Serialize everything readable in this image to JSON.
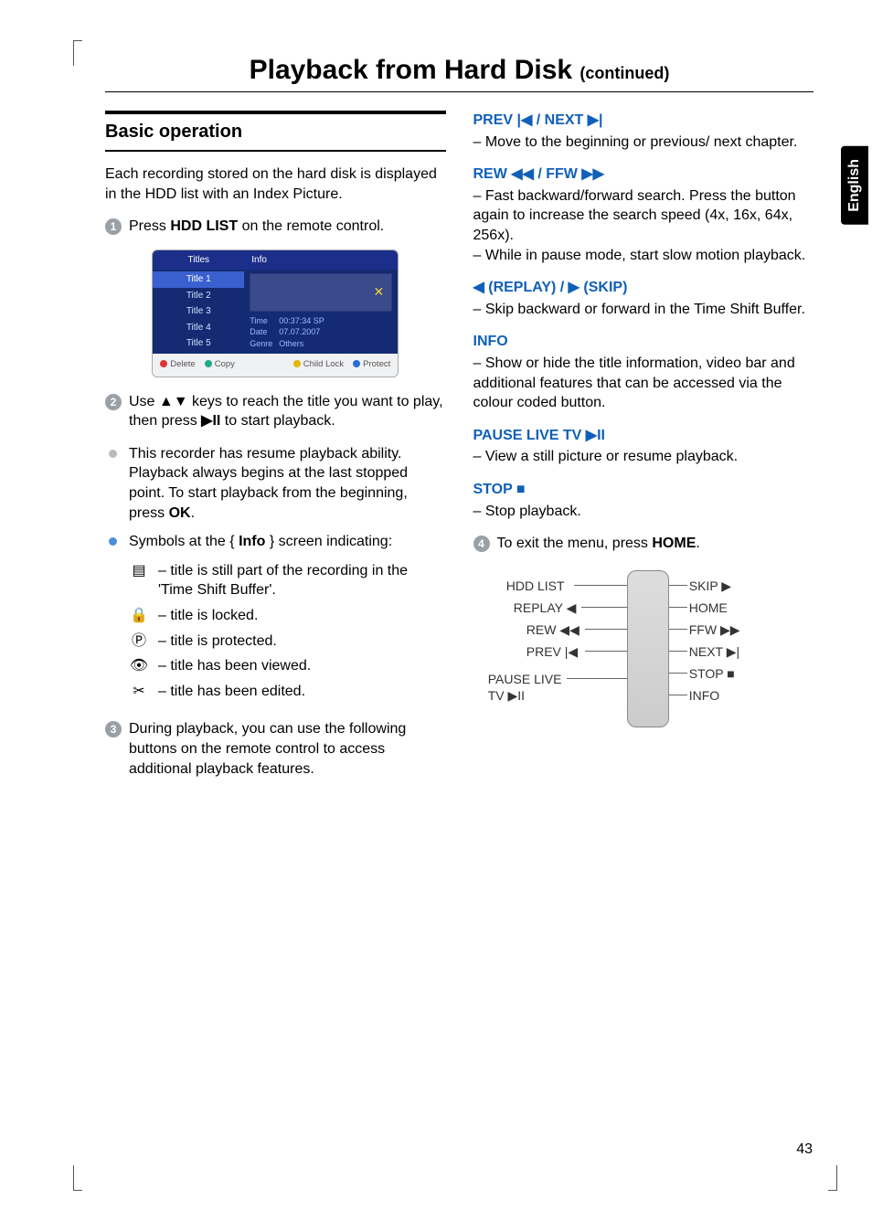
{
  "page_title_main": "Playback from Hard Disk",
  "page_title_cont": "(continued)",
  "language_tab": "English",
  "page_number": "43",
  "left": {
    "heading": "Basic operation",
    "intro": "Each recording stored on the hard disk is displayed in the HDD list with an Index Picture.",
    "step1_a": "Press ",
    "step1_b": "HDD LIST",
    "step1_c": " on the remote control.",
    "hdd": {
      "col_titles": "Titles",
      "col_info": "Info",
      "titles": [
        "Title 1",
        "Title 2",
        "Title 3",
        "Title 4",
        "Title 5"
      ],
      "meta_time_k": "Time",
      "meta_time_v": "00:37:34  SP",
      "meta_date_k": "Date",
      "meta_date_v": "07.07.2007",
      "meta_genre_k": "Genre",
      "meta_genre_v": "Others",
      "foot_delete": "Delete",
      "foot_copy": "Copy",
      "foot_childlock": "Child Lock",
      "foot_protect": "Protect"
    },
    "step2_a": "Use ▲▼ keys to reach the title you want to play, then press ",
    "step2_b": "▶II",
    "step2_c": " to start playback.",
    "bullet_resume_a": "This recorder has resume playback ability.  Playback always begins at the last stopped point.  To start playback from the beginning, press ",
    "bullet_resume_b": "OK",
    "bullet_resume_c": ".",
    "bullet_symbols_a": "Symbols at the { ",
    "bullet_symbols_b": "Info",
    "bullet_symbols_c": " } screen indicating:",
    "sym_tsb": "– title is still part of the recording in the 'Time Shift Buffer'.",
    "sym_locked": "– title is locked.",
    "sym_protected": "– title is protected.",
    "sym_viewed": "– title has been viewed.",
    "sym_edited": "– title has been edited.",
    "step3": "During playback, you can use the following buttons on the remote control to access additional playback features."
  },
  "right": {
    "prev_next_h": "PREV |◀ / NEXT ▶|",
    "prev_next_b": "–  Move to the beginning or previous/ next chapter.",
    "rew_ffw_h": "REW ◀◀ / FFW ▶▶",
    "rew_ffw_b1": "–   Fast backward/forward search.  Press the button again to increase the search speed (4x, 16x, 64x, 256x).",
    "rew_ffw_b2": "–   While in pause mode, start slow motion playback.",
    "replay_skip_h": "◀ (REPLAY) / ▶ (SKIP)",
    "replay_skip_b": "–   Skip backward or forward in the Time Shift Buffer.",
    "info_h": "INFO",
    "info_b": "–   Show or hide the title information, video bar and additional features that can be accessed via the colour coded button.",
    "pause_h": "PAUSE LIVE TV ▶II",
    "pause_b": "–   View a still picture or resume playback.",
    "stop_h": "STOP ■",
    "stop_b": "–  Stop playback.",
    "step4_a": "To exit the menu, press ",
    "step4_b": "HOME",
    "step4_c": ".",
    "remote": {
      "hdd_list": "HDD LIST",
      "replay": "REPLAY ◀",
      "rew": "REW ◀◀",
      "prev": "PREV |◀",
      "pause": "PAUSE LIVE",
      "pause2": "TV ▶II",
      "skip": "SKIP ▶",
      "home": "HOME",
      "ffw": "FFW ▶▶",
      "next": "NEXT ▶|",
      "stop": "STOP ■",
      "info": "INFO"
    }
  }
}
